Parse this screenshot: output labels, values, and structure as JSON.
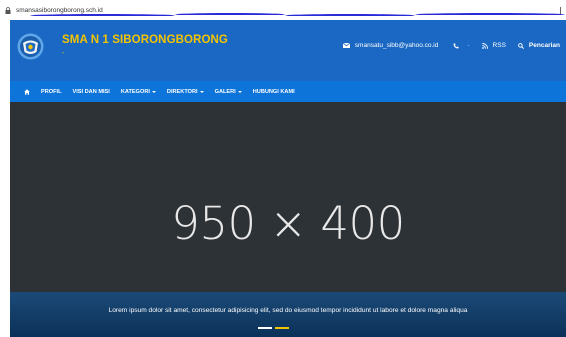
{
  "browser": {
    "url": "smansasiborongborong.sch.id"
  },
  "site": {
    "title": "SMA N 1 SIBORONGBORONG",
    "tagline": "-",
    "email": "smansatu_sibb@yahoo.co.id",
    "phone": "-",
    "rss_label": "RSS",
    "search_label": "Pencarian"
  },
  "nav": {
    "items": [
      {
        "label": "PROFIL"
      },
      {
        "label": "VISI DAN MISI"
      },
      {
        "label": "KATEGORI",
        "dropdown": true
      },
      {
        "label": "DIREKTORI",
        "dropdown": true
      },
      {
        "label": "GALERI",
        "dropdown": true
      },
      {
        "label": "HUBUNGI KAMI"
      }
    ]
  },
  "slider": {
    "placeholder": "950 × 400",
    "caption": "Lorem ipsum dolor sit amet, consectetur adipisicing elit, sed do eiusmod tempor incididunt ut labore et dolore magna aliqua",
    "indicators": [
      {
        "active": false
      },
      {
        "active": true
      }
    ]
  },
  "colors": {
    "header_bg": "#1a68c3",
    "nav_bg": "#0d74d9",
    "brand_yellow": "#f5c400",
    "hero_bg": "#2d3237",
    "caption_bg": "#0b3158"
  },
  "icons": [
    "lock-icon",
    "school-logo",
    "envelope-icon",
    "phone-icon",
    "rss-icon",
    "search-icon",
    "home-icon"
  ]
}
